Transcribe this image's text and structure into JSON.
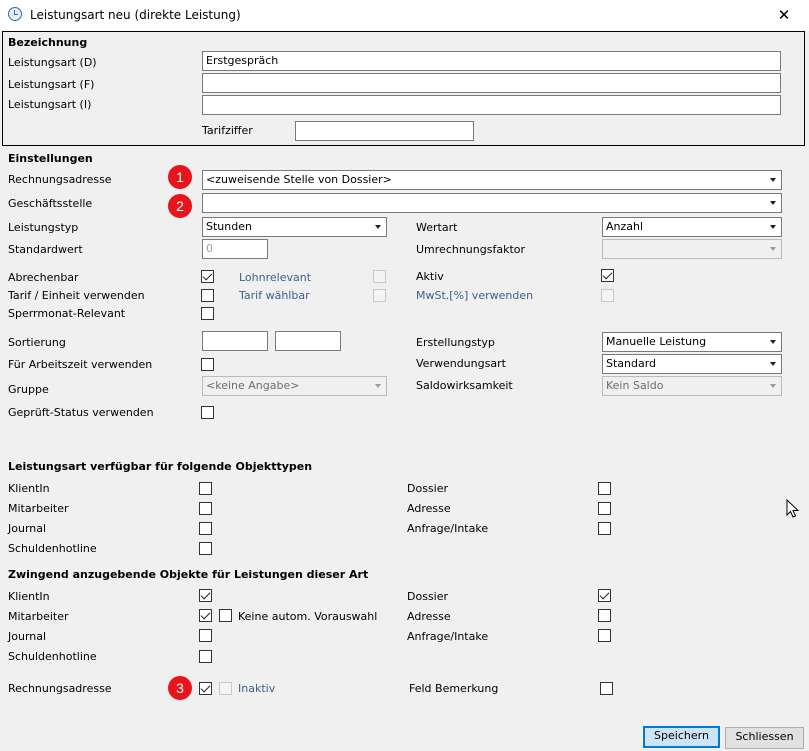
{
  "window": {
    "title": "Leistungsart neu (direkte Leistung)",
    "close_glyph": "✕"
  },
  "bezeichnung": {
    "header": "Bezeichnung",
    "lbl_d": "Leistungsart (D)",
    "val_d": "Erstgespräch",
    "lbl_f": "Leistungsart (F)",
    "val_f": "",
    "lbl_i": "Leistungsart (I)",
    "val_i": "",
    "lbl_tarif": "Tarifziffer",
    "val_tarif": ""
  },
  "einstellungen": {
    "header": "Einstellungen",
    "rechnungsadresse": {
      "label": "Rechnungsadresse",
      "value": "<zuweisende Stelle von Dossier>"
    },
    "geschaeftsstelle": {
      "label": "Geschäftsstelle",
      "value": ""
    },
    "leistungstyp": {
      "label": "Leistungstyp",
      "value": "Stunden"
    },
    "wertart": {
      "label": "Wertart",
      "value": "Anzahl"
    },
    "standardwert": {
      "label": "Standardwert",
      "value": "0"
    },
    "umrechnungsfaktor": {
      "label": "Umrechnungsfaktor",
      "value": ""
    },
    "abrechenbar": {
      "label": "Abrechenbar",
      "checked": true
    },
    "lohnrelevant": {
      "label": "Lohnrelevant",
      "checked": false
    },
    "aktiv": {
      "label": "Aktiv",
      "checked": true
    },
    "tarif_einheit": {
      "label": "Tarif / Einheit verwenden",
      "checked": false
    },
    "tarif_waehlbar": {
      "label": "Tarif wählbar",
      "checked": false
    },
    "mwst": {
      "label": "MwSt.[%] verwenden",
      "checked": false
    },
    "sperrmonat": {
      "label": "Sperrmonat-Relevant",
      "checked": false
    },
    "sortierung": {
      "label": "Sortierung",
      "value1": "",
      "value2": ""
    },
    "erstellungstyp": {
      "label": "Erstellungstyp",
      "value": "Manuelle Leistung"
    },
    "arbeitszeit": {
      "label": "Für Arbeitszeit verwenden",
      "checked": false
    },
    "verwendungsart": {
      "label": "Verwendungsart",
      "value": "Standard"
    },
    "gruppe": {
      "label": "Gruppe",
      "value": "<keine Angabe>"
    },
    "saldowirksamkeit": {
      "label": "Saldowirksamkeit",
      "value": "Kein Saldo"
    },
    "geprueft": {
      "label": "Geprüft-Status verwenden",
      "checked": false
    }
  },
  "verfuegbar": {
    "header": "Leistungsart verfügbar für folgende Objekttypen",
    "klientin": "KlientIn",
    "mitarbeiter": "Mitarbeiter",
    "journal": "Journal",
    "schuldenhotline": "Schuldenhotline",
    "dossier": "Dossier",
    "adresse": "Adresse",
    "anfrage": "Anfrage/Intake"
  },
  "zwingend": {
    "header": "Zwingend anzugebende Objekte für Leistungen dieser Art",
    "klientin": "KlientIn",
    "mitarbeiter": "Mitarbeiter",
    "keine_autom": "Keine autom. Vorauswahl",
    "journal": "Journal",
    "schuldenhotline": "Schuldenhotline",
    "dossier": "Dossier",
    "adresse": "Adresse",
    "anfrage": "Anfrage/Intake",
    "rechnungsadresse": "Rechnungsadresse",
    "inaktiv": "Inaktiv",
    "feld_bemerkung": "Feld Bemerkung"
  },
  "badges": [
    "1",
    "2",
    "3"
  ],
  "buttons": {
    "save": "Speichern",
    "close": "Schliessen"
  },
  "colors": {
    "badge": "#e8141c",
    "primary_border": "#0078d7",
    "disabled_label": "#3c5f8c"
  }
}
